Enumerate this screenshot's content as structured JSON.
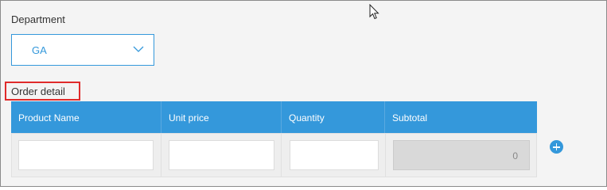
{
  "department": {
    "label": "Department",
    "selected_value": "GA"
  },
  "order_detail": {
    "label": "Order detail",
    "columns": [
      "Product Name",
      "Unit price",
      "Quantity",
      "Subtotal"
    ],
    "row": {
      "product_name": "",
      "unit_price": "",
      "quantity": "",
      "subtotal": "0"
    }
  },
  "colors": {
    "accent": "#3498db",
    "highlight_border": "#e02b2b",
    "background": "#f4f4f4"
  },
  "icons": {
    "dropdown": "chevron-down-icon",
    "add_row": "plus-circle-icon",
    "cursor": "mouse-cursor-icon"
  }
}
